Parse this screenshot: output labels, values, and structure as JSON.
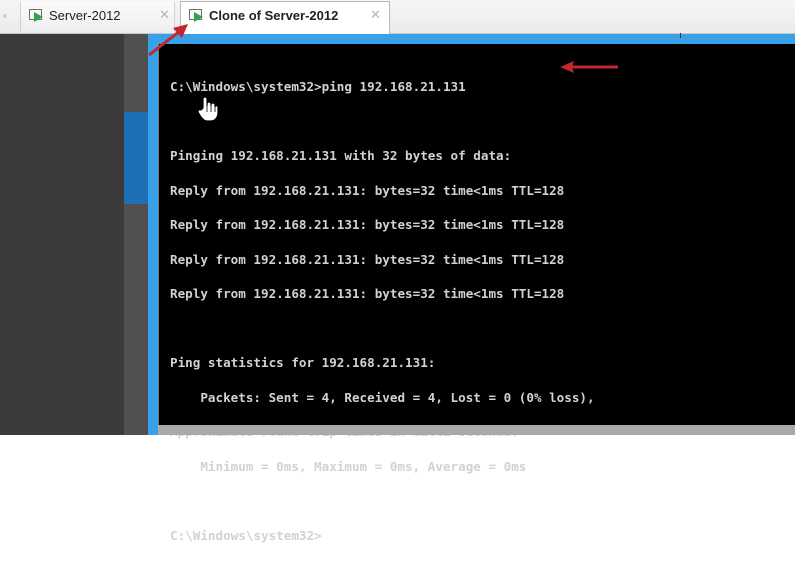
{
  "tabs": [
    {
      "label": "Server-2012",
      "icon": "vm-play-icon",
      "active": false
    },
    {
      "label": "Clone of Server-2012",
      "icon": "vm-play-icon",
      "active": true
    }
  ],
  "console": {
    "lines": [
      "C:\\Windows\\system32>ping 192.168.21.131",
      "",
      "Pinging 192.168.21.131 with 32 bytes of data:",
      "Reply from 192.168.21.131: bytes=32 time<1ms TTL=128",
      "Reply from 192.168.21.131: bytes=32 time<1ms TTL=128",
      "Reply from 192.168.21.131: bytes=32 time<1ms TTL=128",
      "Reply from 192.168.21.131: bytes=32 time<1ms TTL=128",
      "",
      "Ping statistics for 192.168.21.131:",
      "    Packets: Sent = 4, Received = 4, Lost = 0 (0% loss),",
      "Approximate round trip times in milli-seconds:",
      "    Minimum = 0ms, Maximum = 0ms, Average = 0ms",
      "",
      "C:\\Windows\\system32>"
    ],
    "text_color": "#d2d2d2",
    "background": "#000000"
  },
  "colors": {
    "accent_blue": "#3aa0e8",
    "annotation_red": "#c1272d",
    "vm_icon_green": "#2ea44f"
  }
}
